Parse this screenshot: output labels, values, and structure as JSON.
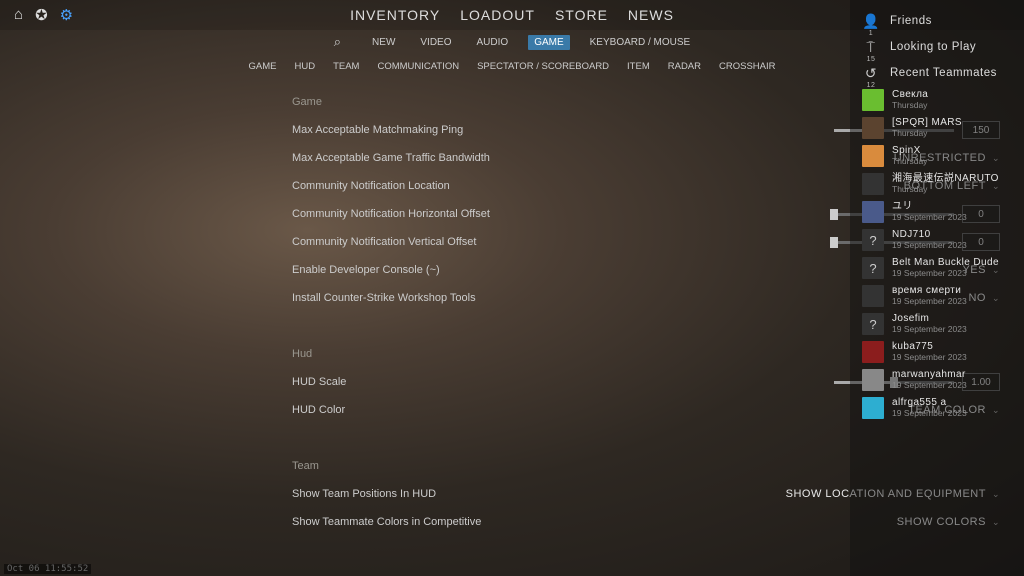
{
  "topbar_icons": [
    "⌂",
    "✪",
    "⚙"
  ],
  "topnav": [
    "INVENTORY",
    "LOADOUT",
    "STORE",
    "NEWS"
  ],
  "subnav1": {
    "items": [
      "NEW",
      "VIDEO",
      "AUDIO",
      "GAME",
      "KEYBOARD / MOUSE"
    ],
    "selected": "GAME"
  },
  "subnav2": [
    "GAME",
    "HUD",
    "TEAM",
    "COMMUNICATION",
    "SPECTATOR / SCOREBOARD",
    "ITEM",
    "RADAR",
    "CROSSHAIR"
  ],
  "sections": [
    {
      "title": "Game",
      "rows": [
        {
          "label": "Max Acceptable Matchmaking Ping",
          "type": "slider",
          "value": "150",
          "pct": 33
        },
        {
          "label": "Max Acceptable Game Traffic Bandwidth",
          "type": "dropdown",
          "value": "UNRESTRICTED"
        },
        {
          "label": "Community Notification Location",
          "type": "dropdown",
          "value": "BOTTOM LEFT"
        },
        {
          "label": "Community Notification Horizontal Offset",
          "type": "slider",
          "value": "0",
          "pct": 0
        },
        {
          "label": "Community Notification Vertical Offset",
          "type": "slider",
          "value": "0",
          "pct": 0
        },
        {
          "label": "Enable Developer Console (~)",
          "type": "dropdown",
          "value": "YES"
        },
        {
          "label": "Install Counter-Strike Workshop Tools",
          "type": "dropdown",
          "value": "NO"
        }
      ]
    },
    {
      "title": "Hud",
      "rows": [
        {
          "label": "HUD Scale",
          "type": "slider",
          "value": "1.00",
          "pct": 50
        },
        {
          "label": "HUD Color",
          "type": "dropdown",
          "value": "TEAM COLOR"
        }
      ]
    },
    {
      "title": "Team",
      "rows": [
        {
          "label": "Show Team Positions In HUD",
          "type": "dropdown",
          "value": "SHOW LOCATION AND EQUIPMENT"
        },
        {
          "label": "Show Teammate Colors in Competitive",
          "type": "dropdown",
          "value": "SHOW COLORS"
        }
      ]
    }
  ],
  "sidebar": {
    "friends": {
      "label": "Friends",
      "count": "1"
    },
    "looking": {
      "label": "Looking to Play",
      "count": "15"
    },
    "recent": {
      "label": "Recent Teammates",
      "count": "12"
    },
    "players": [
      {
        "name": "Свекла",
        "date": "Thursday",
        "color": "#6abe30"
      },
      {
        "name": "[SPQR] MARS",
        "date": "Thursday",
        "color": "#5b432f"
      },
      {
        "name": "SpinX",
        "date": "Thursday",
        "color": "#d98b3d"
      },
      {
        "name": "湘海最速伝説NARUTO",
        "date": "Thursday",
        "color": "#333"
      },
      {
        "name": "ユリ",
        "date": "19 September 2023",
        "color": "#4a5a8a"
      },
      {
        "name": "NDJ710",
        "date": "19 September 2023",
        "color": "#333",
        "avatar": "?"
      },
      {
        "name": "Belt Man Buckle Dude",
        "date": "19 September 2023",
        "color": "#333",
        "avatar": "?"
      },
      {
        "name": "время смерти",
        "date": "19 September 2023",
        "color": "#333"
      },
      {
        "name": "Josefim",
        "date": "19 September 2023",
        "color": "#333",
        "avatar": "?"
      },
      {
        "name": "kuba775",
        "date": "19 September 2023",
        "color": "#8b1d1d"
      },
      {
        "name": "marwanyahmar",
        "date": "19 September 2023",
        "color": "#888"
      },
      {
        "name": "alfrga555 a",
        "date": "19 September 2023",
        "color": "#2daed1"
      }
    ]
  },
  "timestamp": "Oct 06 11:55:52"
}
